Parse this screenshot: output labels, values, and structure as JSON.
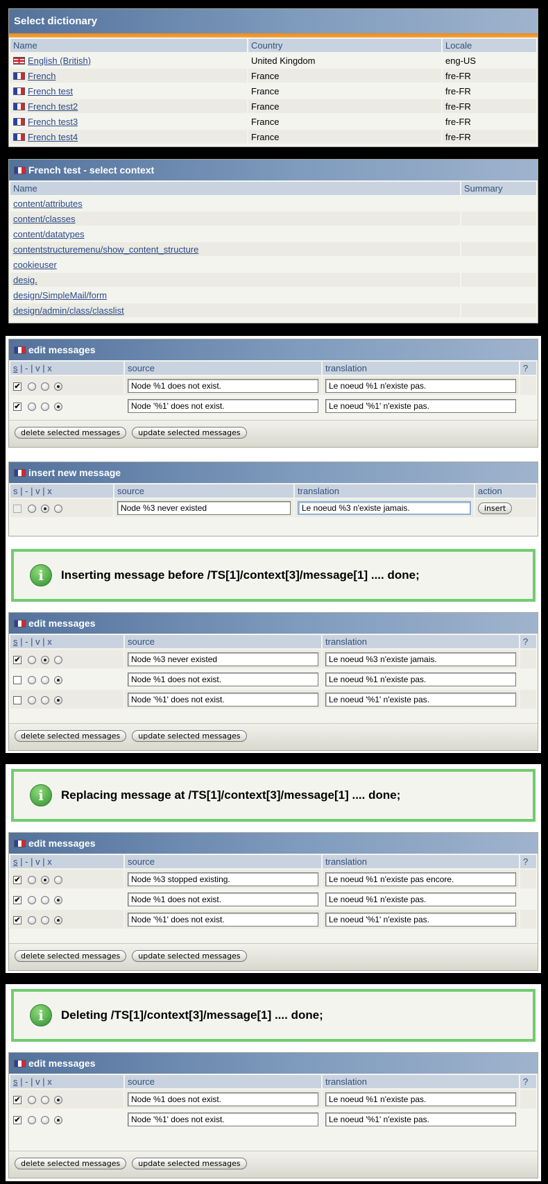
{
  "dictionary": {
    "title": "Select dictionary",
    "headers": [
      "Name",
      "Country",
      "Locale"
    ],
    "rows": [
      {
        "name": "English (British)",
        "country": "United Kingdom",
        "locale": "eng-US",
        "flag": "uk-flag"
      },
      {
        "name": "French",
        "country": "France",
        "locale": "fre-FR",
        "flag": "fr-flag"
      },
      {
        "name": "French test",
        "country": "France",
        "locale": "fre-FR",
        "flag": "fr-flag"
      },
      {
        "name": "French test2",
        "country": "France",
        "locale": "fre-FR",
        "flag": "fr-flag"
      },
      {
        "name": "French test3",
        "country": "France",
        "locale": "fre-FR",
        "flag": "fr-flag"
      },
      {
        "name": "French test4",
        "country": "France",
        "locale": "fre-FR",
        "flag": "fr-flag"
      }
    ]
  },
  "context": {
    "title": "French test - select context",
    "headers": [
      "Name",
      "Summary"
    ],
    "items": [
      "content/attributes",
      "content/classes",
      "content/datatypes",
      "contentstructuremenu/show_content_structure",
      "cookieuser",
      "desig.",
      "design/SimpleMail/form",
      "design/admin/class/classlist"
    ]
  },
  "edit_common": {
    "title": "edit messages",
    "col_s": "s",
    "col_dash": "-",
    "col_v": "v",
    "col_x": "x",
    "sep": "|",
    "col_source": "source",
    "col_translation": "translation",
    "col_help": "?",
    "delete_label": "delete selected messages",
    "update_label": "update selected messages"
  },
  "edit1": {
    "rows": [
      {
        "checked": true,
        "radio": "x",
        "source": "Node %1 does not exist.",
        "translation": "Le noeud %1 n'existe pas."
      },
      {
        "checked": true,
        "radio": "x",
        "source": "Node '%1' does not exist.",
        "translation": "Le noeud '%1' n'existe pas."
      }
    ]
  },
  "insert": {
    "title": "insert new message",
    "col_source": "source",
    "col_translation": "translation",
    "col_action": "action",
    "source": "Node %3 never existed",
    "translation": "Le noeud %3 n'existe jamais.",
    "insert_label": "insert"
  },
  "messages": [
    "Inserting message before /TS[1]/context[3]/message[1] .... done;",
    "Replacing message at /TS[1]/context[3]/message[1] .... done;",
    "Deleting /TS[1]/context[3]/message[1] .... done;"
  ],
  "edit2": {
    "rows": [
      {
        "checked": true,
        "radio": "v",
        "source": "Node %3 never existed",
        "translation": "Le noeud %3 n'existe jamais."
      },
      {
        "checked": false,
        "radio": "x",
        "source": "Node %1 does not exist.",
        "translation": "Le noeud %1 n'existe pas."
      },
      {
        "checked": false,
        "radio": "x",
        "source": "Node '%1' does not exist.",
        "translation": "Le noeud '%1' n'existe pas."
      }
    ]
  },
  "edit3": {
    "rows": [
      {
        "checked": true,
        "radio": "v",
        "source": "Node %3 stopped existing.",
        "translation": "Le noeud %1 n'existe pas encore."
      },
      {
        "checked": true,
        "radio": "x",
        "source": "Node %1 does not exist.",
        "translation": "Le noeud %1 n'existe pas."
      },
      {
        "checked": true,
        "radio": "x",
        "source": "Node '%1' does not exist.",
        "translation": "Le noeud '%1' n'existe pas."
      }
    ]
  },
  "edit4": {
    "rows": [
      {
        "checked": true,
        "radio": "x",
        "source": "Node %1 does not exist.",
        "translation": "Le noeud %1 n'existe pas."
      },
      {
        "checked": true,
        "radio": "x",
        "source": "Node '%1' does not exist.",
        "translation": "Le noeud '%1' n'existe pas."
      }
    ]
  },
  "colors": {
    "title_bar": "#53729c",
    "header_cell": "#c9d3df",
    "accent_orange": "#e98c1c",
    "success_border": "#72cc6f"
  }
}
